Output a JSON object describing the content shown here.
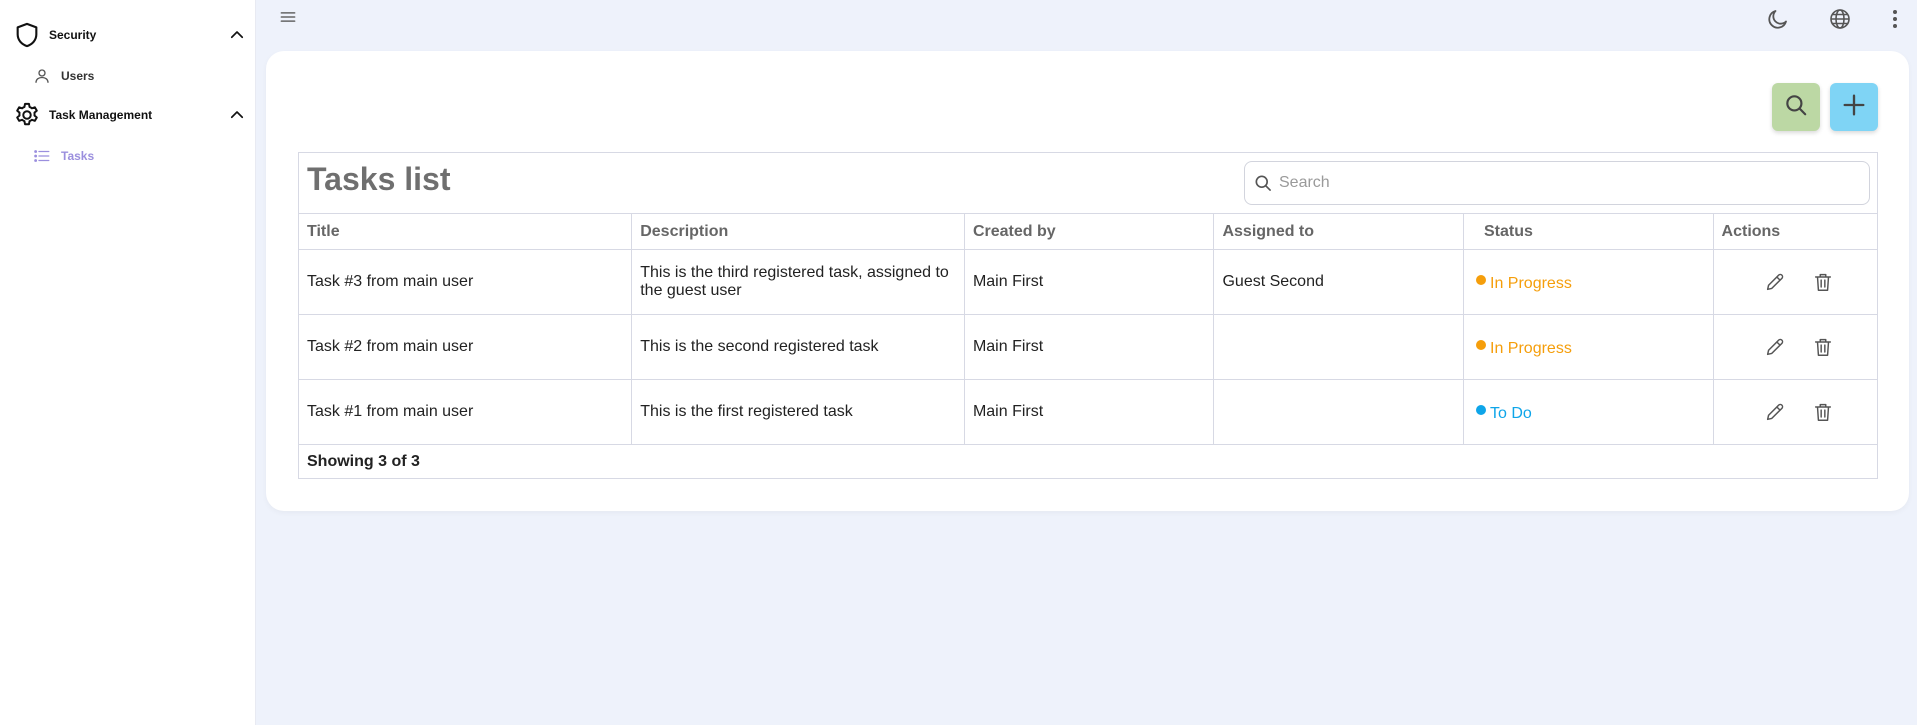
{
  "sidebar": {
    "groups": [
      {
        "label": "Security",
        "icon": "shield-icon",
        "items": [
          {
            "label": "Users",
            "icon": "user-icon",
            "active": false
          }
        ]
      },
      {
        "label": "Task Management",
        "icon": "gear-icon",
        "items": [
          {
            "label": "Tasks",
            "icon": "list-icon",
            "active": true
          }
        ]
      }
    ]
  },
  "topbar": {
    "icons": [
      "hamburger-menu-icon",
      "moon-icon",
      "globe-icon",
      "more-vertical-icon"
    ]
  },
  "main": {
    "title": "Tasks list",
    "search": {
      "placeholder": "Search",
      "value": ""
    },
    "columns": [
      "Title",
      "Description",
      "Created by",
      "Assigned to",
      "Status",
      "Actions"
    ],
    "rows": [
      {
        "title": "Task #3 from main user",
        "description": "This is the third registered task, assigned to the guest user",
        "created_by": "Main First",
        "assigned_to": "Guest Second",
        "status": "In Progress"
      },
      {
        "title": "Task #2 from main user",
        "description": "This is the second registered task",
        "created_by": "Main First",
        "assigned_to": "",
        "status": "In Progress"
      },
      {
        "title": "Task #1 from main user",
        "description": "This is the first registered task",
        "created_by": "Main First",
        "assigned_to": "",
        "status": "To Do"
      }
    ],
    "footer": "Showing 3 of 3"
  },
  "colors": {
    "in_progress": "#f59e0b",
    "to_do": "#0ea5e9",
    "active_nav": "#9b8fde",
    "search_fab": "#bcd8a4",
    "add_fab": "#7fd4f5"
  }
}
